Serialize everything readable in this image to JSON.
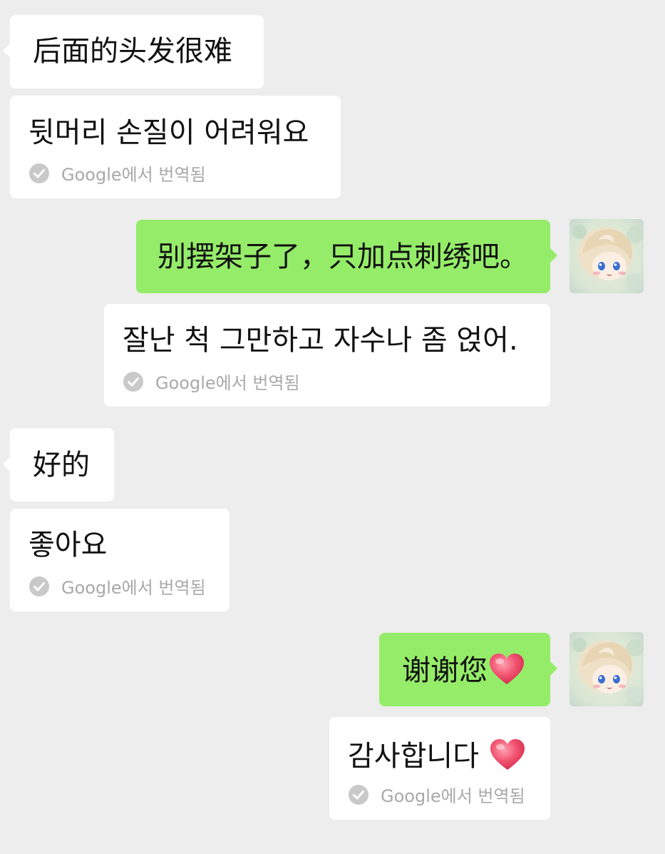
{
  "messages": [
    {
      "side": "left",
      "original": "后面的头发很难",
      "translation": "뒷머리 손질이 어려워요",
      "translation_note": "Google에서 번역됨"
    },
    {
      "side": "right",
      "original": "别摆架子了，只加点刺绣吧。",
      "translation": "잘난 척 그만하고 자수나 좀 얹어.",
      "translation_note": "Google에서 번역됨"
    },
    {
      "side": "left",
      "original": "好的",
      "translation": "좋아요",
      "translation_note": "Google에서 번역됨"
    },
    {
      "side": "right",
      "original": "谢谢您",
      "translation": "감사합니다",
      "translation_note": "Google에서 번역됨"
    }
  ],
  "icons": {
    "translation_check": "check-circle-icon",
    "emoji": "heart-icon",
    "avatar": "avatar"
  },
  "colors": {
    "background": "#ededed",
    "received_bubble": "#ffffff",
    "sent_bubble": "#95ec69",
    "translation_note": "#a9a9a9",
    "heart": "#f0506e"
  }
}
